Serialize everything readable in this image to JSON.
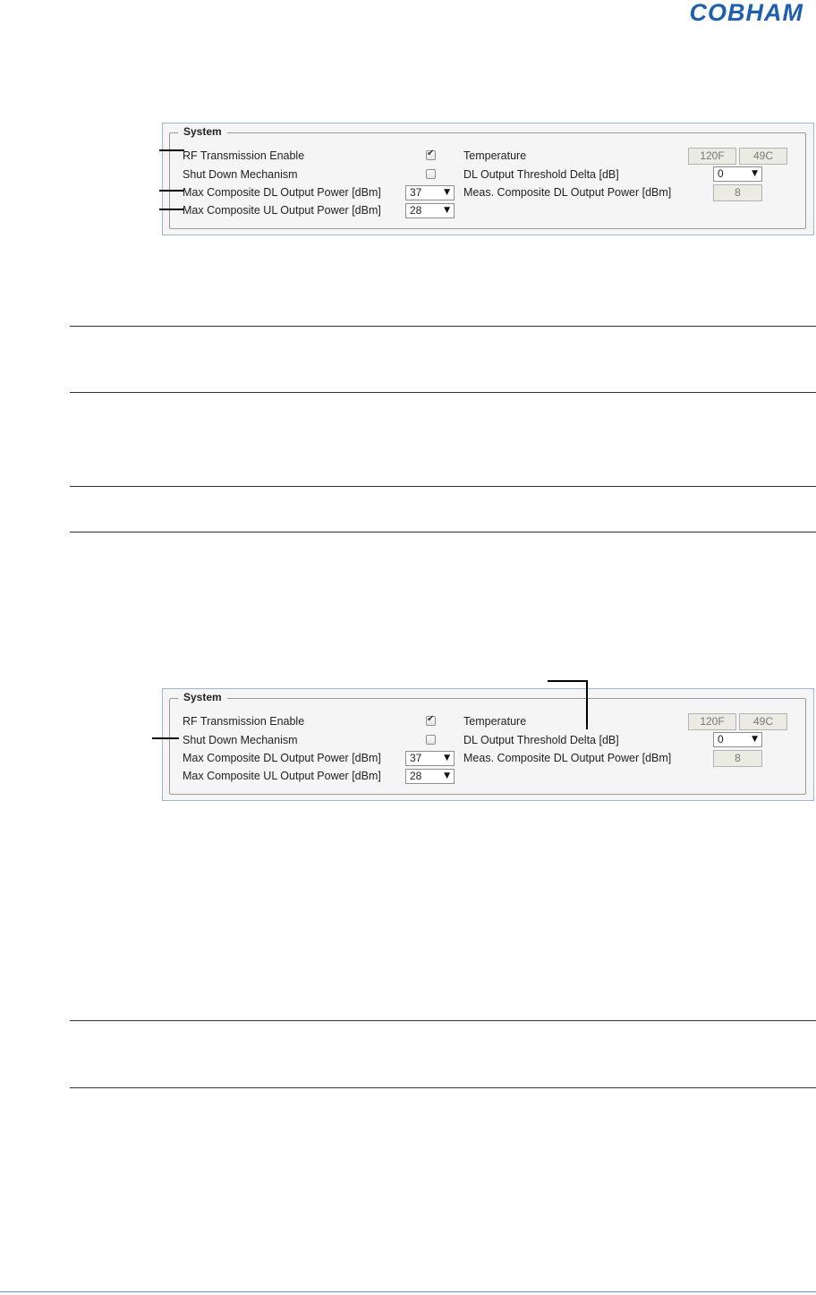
{
  "brand": {
    "logo_text": "COBHAM",
    "color": "#1f5fb0"
  },
  "panels": [
    {
      "legend": "System",
      "rf_label": "RF Transmission Enable",
      "rf_checked": true,
      "shutdown_label": "Shut Down Mechanism",
      "shutdown_checked": false,
      "max_dl_label": "Max Composite DL Output Power [dBm]",
      "max_dl_value": "37",
      "max_ul_label": "Max Composite UL Output Power [dBm]",
      "max_ul_value": "28",
      "temp_label": "Temperature",
      "temp_f": "120F",
      "temp_c": "49C",
      "dl_thresh_label": "DL Output Threshold Delta [dB]",
      "dl_thresh_value": "0",
      "meas_dl_label": "Meas. Composite DL Output Power [dBm]",
      "meas_dl_value": "8"
    },
    {
      "legend": "System",
      "rf_label": "RF Transmission Enable",
      "rf_checked": true,
      "shutdown_label": "Shut Down Mechanism",
      "shutdown_checked": false,
      "max_dl_label": "Max Composite DL Output Power [dBm]",
      "max_dl_value": "37",
      "max_ul_label": "Max Composite UL Output Power [dBm]",
      "max_ul_value": "28",
      "temp_label": "Temperature",
      "temp_f": "120F",
      "temp_c": "49C",
      "dl_thresh_label": "DL Output Threshold Delta [dB]",
      "dl_thresh_value": "0",
      "meas_dl_label": "Meas. Composite DL Output Power [dBm]",
      "meas_dl_value": "8"
    }
  ]
}
